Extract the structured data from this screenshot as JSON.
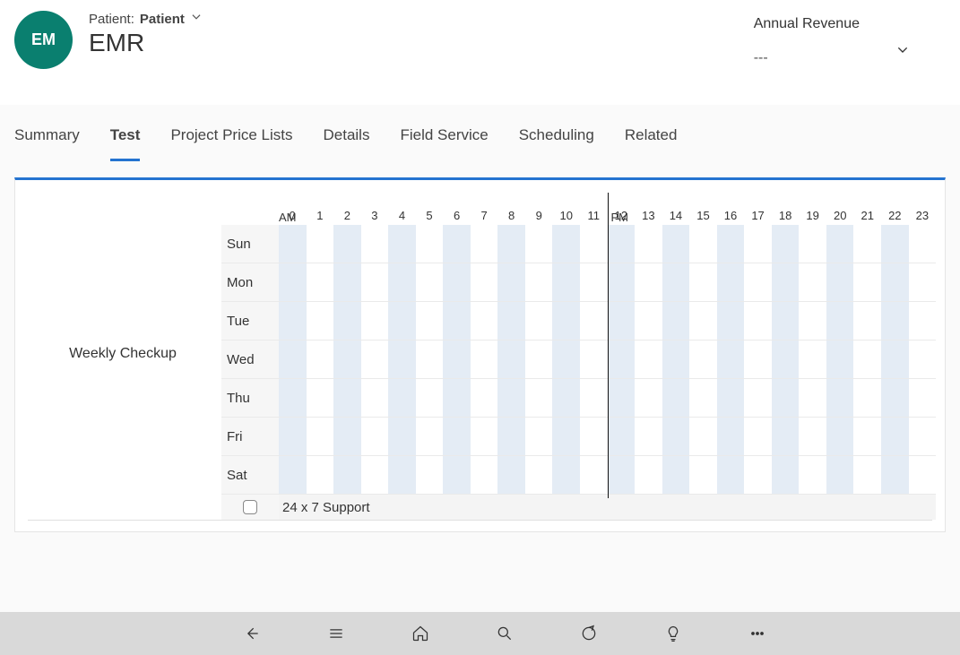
{
  "header": {
    "avatar_initials": "EM",
    "breadcrumb_label": "Patient:",
    "breadcrumb_value": "Patient",
    "page_title": "EMR",
    "revenue_label": "Annual Revenue",
    "revenue_value": "---"
  },
  "tabs": [
    {
      "label": "Summary",
      "active": false
    },
    {
      "label": "Test",
      "active": true
    },
    {
      "label": "Project Price Lists",
      "active": false
    },
    {
      "label": "Details",
      "active": false
    },
    {
      "label": "Field Service",
      "active": false
    },
    {
      "label": "Scheduling",
      "active": false
    },
    {
      "label": "Related",
      "active": false
    }
  ],
  "schedule": {
    "row_name": "Weekly Checkup",
    "am_label": "AM",
    "pm_label": "PM",
    "hours": [
      "0",
      "1",
      "2",
      "3",
      "4",
      "5",
      "6",
      "7",
      "8",
      "9",
      "10",
      "11",
      "12",
      "13",
      "14",
      "15",
      "16",
      "17",
      "18",
      "19",
      "20",
      "21",
      "22",
      "23"
    ],
    "days": [
      "Sun",
      "Mon",
      "Tue",
      "Wed",
      "Thu",
      "Fri",
      "Sat"
    ],
    "support_label": "24 x 7 Support",
    "support_checked": false
  },
  "footer_icons": [
    "back",
    "menu",
    "home",
    "search",
    "target",
    "bulb",
    "more"
  ]
}
